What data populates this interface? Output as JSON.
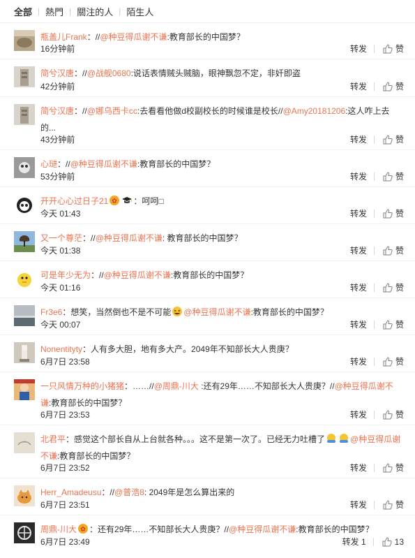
{
  "tabs": [
    "全部",
    "熱門",
    "關注的人",
    "陌生人"
  ],
  "repost_label": "转发",
  "like_label": "赞",
  "comments": [
    {
      "user": "瓶盖儿Frank",
      "sep": "：//",
      "mention1": "@种豆得瓜谢不谦",
      "text1": ":教育部长的中国梦？",
      "mention2": "",
      "text2": "",
      "time": "16分钟前"
    },
    {
      "user": "简兮汉唐",
      "sep": "：//",
      "mention1": "@战舰0680",
      "text1": ":说话表情贼头贼脑，眼神飘忽不定，非奸即盗",
      "mention2": "",
      "text2": "",
      "time": "42分钟前"
    },
    {
      "user": "简兮汉唐",
      "sep": "：//",
      "mention1": "@娜乌西卡cc",
      "text1": ":去看看他做d校副校长的时候谁是校长//",
      "mention2": "@Amy20181206",
      "text2": ":这人咋上去的...",
      "time": "43分钟前"
    },
    {
      "user": "心琎",
      "sep": "：//",
      "mention1": "@种豆得瓜谢不谦",
      "text1": ":教育部长的中国梦？",
      "mention2": "",
      "text2": "",
      "time": "53分钟前"
    },
    {
      "user": "开开心心过日子21",
      "sep": "：",
      "mention1": "",
      "text1": "呵呵□",
      "mention2": "",
      "text2": "",
      "time": "今天 01:43"
    },
    {
      "user": "又一个尊茫",
      "sep": "：//",
      "mention1": "@种豆得瓜谢不谦",
      "text1": ": 教育部长的中国梦？",
      "mention2": "",
      "text2": "",
      "time": "今天 01:38"
    },
    {
      "user": "可是年少无为",
      "sep": "：//",
      "mention1": "@种豆得瓜谢不谦",
      "text1": ":教育部长的中国梦？",
      "mention2": "",
      "text2": "",
      "time": "今天 01:16"
    },
    {
      "user": "Fr3e6",
      "sep": "：",
      "mention1": "",
      "text1": "想笑，当然倒也不是不可能",
      "mention2": "@种豆得瓜谢不谦",
      "text2": ":教育部长的中国梦？",
      "time": "今天 00:07"
    },
    {
      "user": "Nonentityty",
      "sep": "：",
      "mention1": "",
      "text1": "人有多大胆，地有多大产。2049年不知部长大人贵庚？",
      "mention2": "",
      "text2": "",
      "time": "6月7日 23:58"
    },
    {
      "user": "一只风情万种的小猪猪",
      "sep": "：……//",
      "mention1": "@周鼎-川大",
      "text1": " :还有29年……不知部长大人贵庚？//",
      "mention2": "@种豆得瓜谢不谦",
      "text2": ":教育部长的中国梦？",
      "time": "6月7日 23:53"
    },
    {
      "user": "北君平",
      "sep": "：",
      "mention1": "",
      "text1": "感觉这个部长自从上台就各种。。。这不是第一次了。已经无力吐槽了",
      "mention2": "@种豆得瓜谢不谦",
      "text2": ":教育部长的中国梦？",
      "time": "6月7日 23:52"
    },
    {
      "user": "Herr_Amadeusu",
      "sep": "：//",
      "mention1": "@普浩8",
      "text1": ": 2049年是怎么算出来的",
      "mention2": "",
      "text2": "",
      "time": "6月7日 23:51"
    },
    {
      "user": "周鼎-川大",
      "sep": "：",
      "mention1": "",
      "text1": "还有29年……不知部长大人贵庚？//",
      "mention2": "@种豆得瓜谢不谦",
      "text2": ":教育部长的中国梦？",
      "time": "6月7日 23:49",
      "repost": "转发 1",
      "likes": "13"
    }
  ]
}
